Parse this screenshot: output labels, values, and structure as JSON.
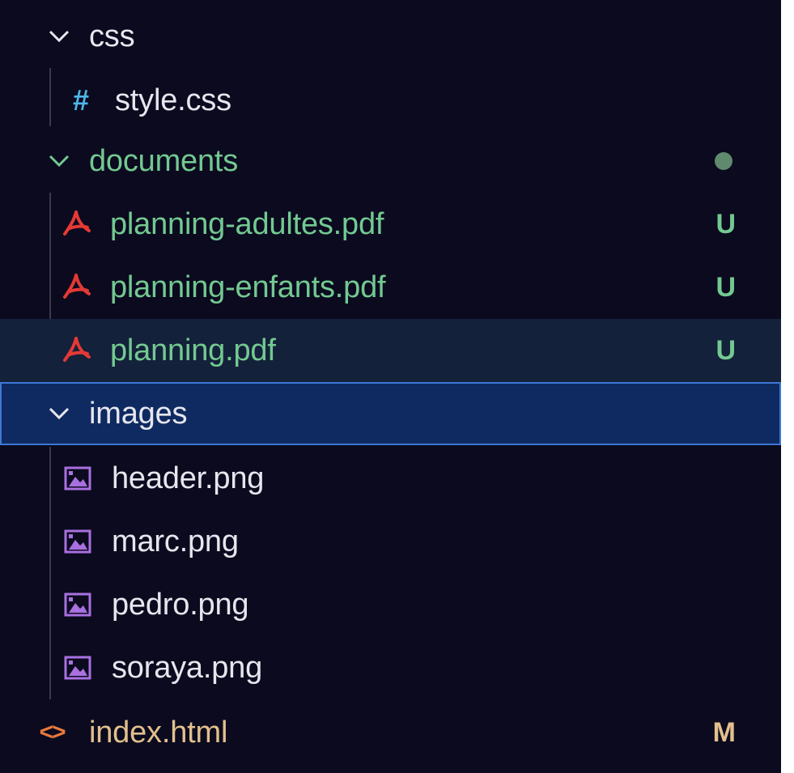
{
  "explorer": {
    "items": [
      {
        "kind": "folder",
        "label": "css",
        "icon": "chevron-down-icon"
      },
      {
        "kind": "file",
        "label": "style.css",
        "icon": "css-hash-icon"
      },
      {
        "kind": "folder",
        "label": "documents",
        "icon": "chevron-down-icon",
        "status": "modified-dot"
      },
      {
        "kind": "file",
        "label": "planning-adultes.pdf",
        "icon": "pdf-icon",
        "badge": "U"
      },
      {
        "kind": "file",
        "label": "planning-enfants.pdf",
        "icon": "pdf-icon",
        "badge": "U"
      },
      {
        "kind": "file",
        "label": "planning.pdf",
        "icon": "pdf-icon",
        "badge": "U"
      },
      {
        "kind": "folder",
        "label": "images",
        "icon": "chevron-down-icon"
      },
      {
        "kind": "file",
        "label": "header.png",
        "icon": "image-icon"
      },
      {
        "kind": "file",
        "label": "marc.png",
        "icon": "image-icon"
      },
      {
        "kind": "file",
        "label": "pedro.png",
        "icon": "image-icon"
      },
      {
        "kind": "file",
        "label": "soraya.png",
        "icon": "image-icon"
      },
      {
        "kind": "file",
        "label": "index.html",
        "icon": "html-code-icon",
        "badge": "M"
      }
    ]
  },
  "colors": {
    "background": "#0b0a1f",
    "default_text": "#e6e6ee",
    "untracked_text": "#73c991",
    "modified_text": "#e2c08d",
    "pdf_icon": "#e53935",
    "image_icon": "#a970e0",
    "css_icon": "#4fb6e8",
    "html_icon": "#e87a3c",
    "selection": "#0f2a60",
    "selection_border": "#3d78d6",
    "hover": "#14213a"
  }
}
